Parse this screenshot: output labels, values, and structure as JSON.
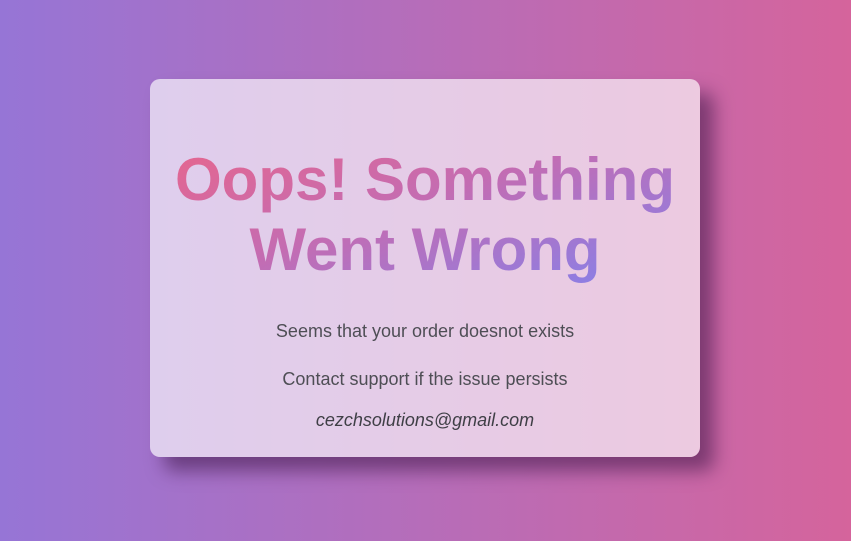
{
  "error": {
    "title_line1": "Oops! Something",
    "title_line2": "Went Wrong",
    "message": "Seems that your order doesnot exists",
    "support_text": "Contact support if the issue persists",
    "email": "cezchsolutions@gmail.com"
  },
  "colors": {
    "background_start": "#9675d6",
    "background_end": "#d5649c",
    "title_gradient_start": "#e8668c",
    "title_gradient_end": "#7f83f0",
    "text": "#4e4e55"
  }
}
